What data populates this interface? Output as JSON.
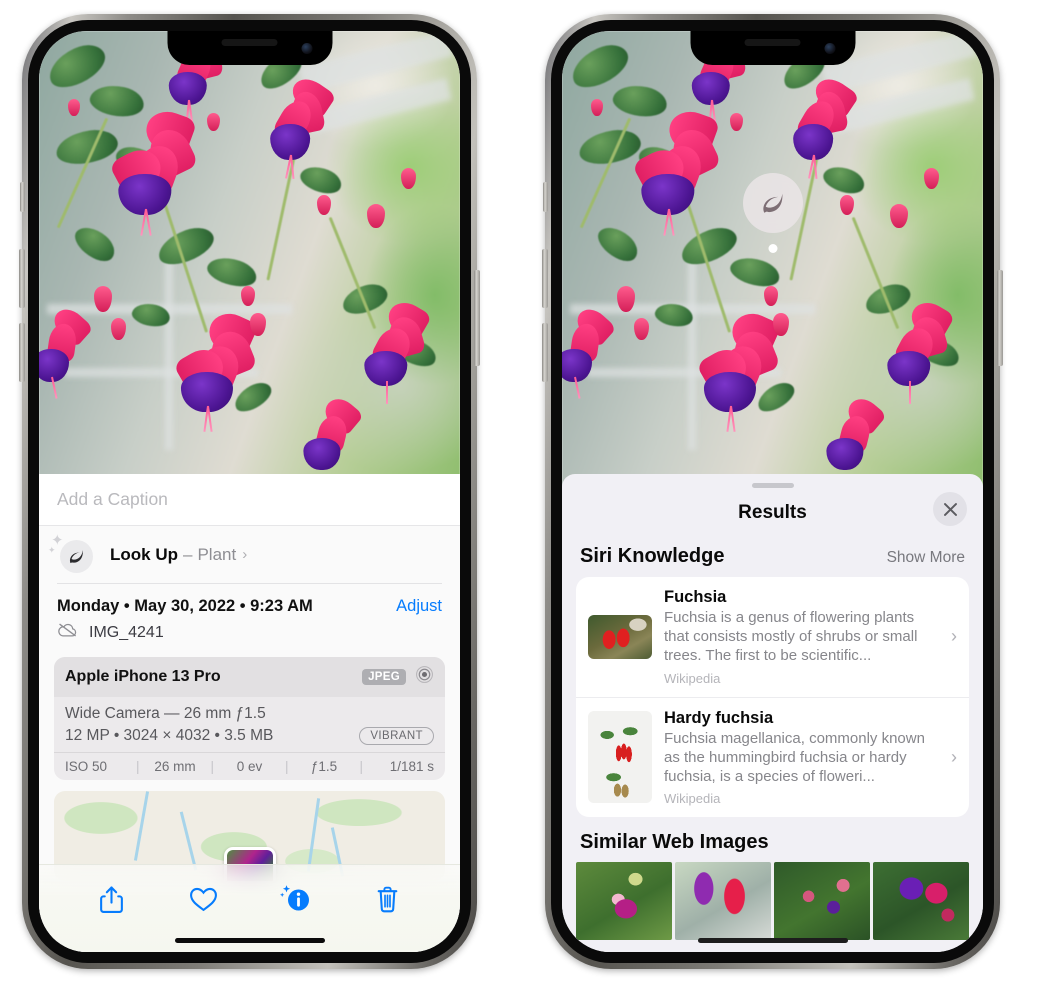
{
  "left_phone": {
    "caption": {
      "placeholder": "Add a Caption",
      "value": ""
    },
    "lookup": {
      "title": "Look Up",
      "separator": "–",
      "subject": "Plant",
      "chevron": "›",
      "icon": "leaf-icon"
    },
    "metadata": {
      "date_line": "Monday • May 30, 2022 • 9:23 AM",
      "adjust_label": "Adjust",
      "filename": "IMG_4241",
      "cloud_icon": "icloud-slash-icon"
    },
    "camera_card": {
      "device": "Apple iPhone 13 Pro",
      "format_badge": "JPEG",
      "aperture_icon": "aperture-icon",
      "lens_line": "Wide Camera — 26 mm ƒ1.5",
      "specs_line": "12 MP • 3024 × 4032 • 3.5 MB",
      "style_badge": "VIBRANT",
      "exif": [
        "ISO 50",
        "26 mm",
        "0 ev",
        "ƒ1.5",
        "1/181 s"
      ]
    },
    "toolbar": [
      {
        "name": "share-button",
        "icon": "share-icon"
      },
      {
        "name": "favorite-button",
        "icon": "heart-icon"
      },
      {
        "name": "info-button",
        "icon": "info-sparkle-icon"
      },
      {
        "name": "delete-button",
        "icon": "trash-icon"
      }
    ],
    "accent_color": "#067cfd"
  },
  "right_phone": {
    "badge": {
      "icon": "leaf-icon",
      "label": "visual-look-up-badge"
    },
    "sheet": {
      "title": "Results",
      "close_label": "✕"
    },
    "siri_knowledge": {
      "section_title": "Siri Knowledge",
      "show_more": "Show More",
      "items": [
        {
          "title": "Fuchsia",
          "description": "Fuchsia is a genus of flowering plants that consists mostly of shrubs or small trees. The first to be scientific...",
          "source": "Wikipedia",
          "chevron": "›"
        },
        {
          "title": "Hardy fuchsia",
          "description": "Fuchsia magellanica, commonly known as the hummingbird fuchsia or hardy fuchsia, is a species of floweri...",
          "source": "Wikipedia",
          "chevron": "›"
        }
      ]
    },
    "similar_web_images": {
      "section_title": "Similar Web Images",
      "tiles": [
        "fuchsia-thumb-1",
        "fuchsia-thumb-2",
        "fuchsia-thumb-3",
        "fuchsia-thumb-4"
      ]
    }
  }
}
